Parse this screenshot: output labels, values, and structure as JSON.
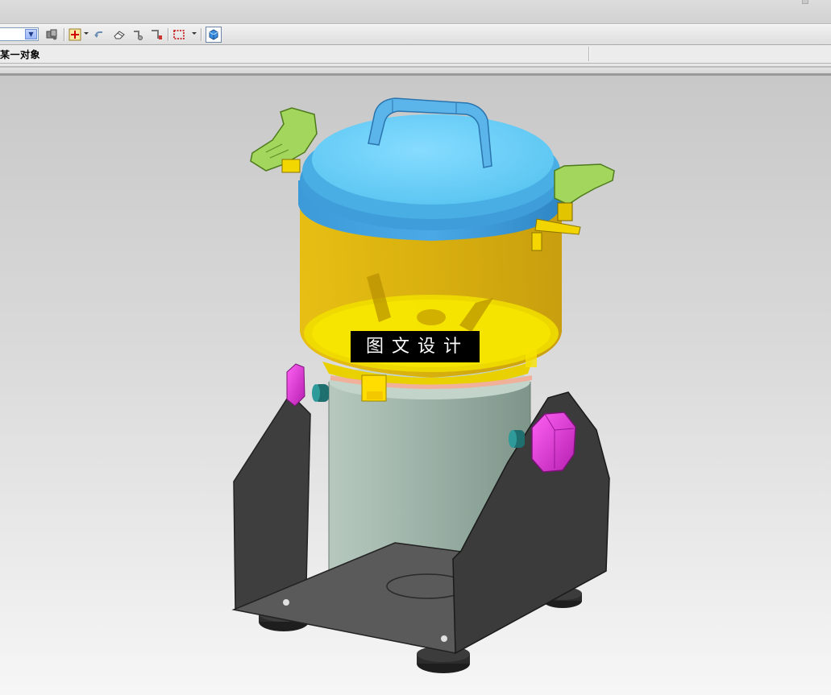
{
  "status": {
    "prompt_text": "某一对象"
  },
  "toolbar": {
    "combo_value": "",
    "icons": [
      "layer-icon",
      "snap-point-icon",
      "undo-arrow-icon",
      "eraser-icon",
      "feature-icon-1",
      "feature-icon-2",
      "select-rectangle-icon",
      "view-cube-icon"
    ]
  },
  "viewport": {
    "background_top": "#c8c8c8",
    "background_bottom": "#f6f6f6",
    "watermark": "图文设计"
  },
  "colors": {
    "lid": "#5fc7f2",
    "bowl": "#e4b800",
    "drum": "#9cb3a8",
    "frame": "#3a3a3a",
    "knob": "#e03cd8",
    "latch": "#9acd50",
    "clip": "#f1d000"
  }
}
